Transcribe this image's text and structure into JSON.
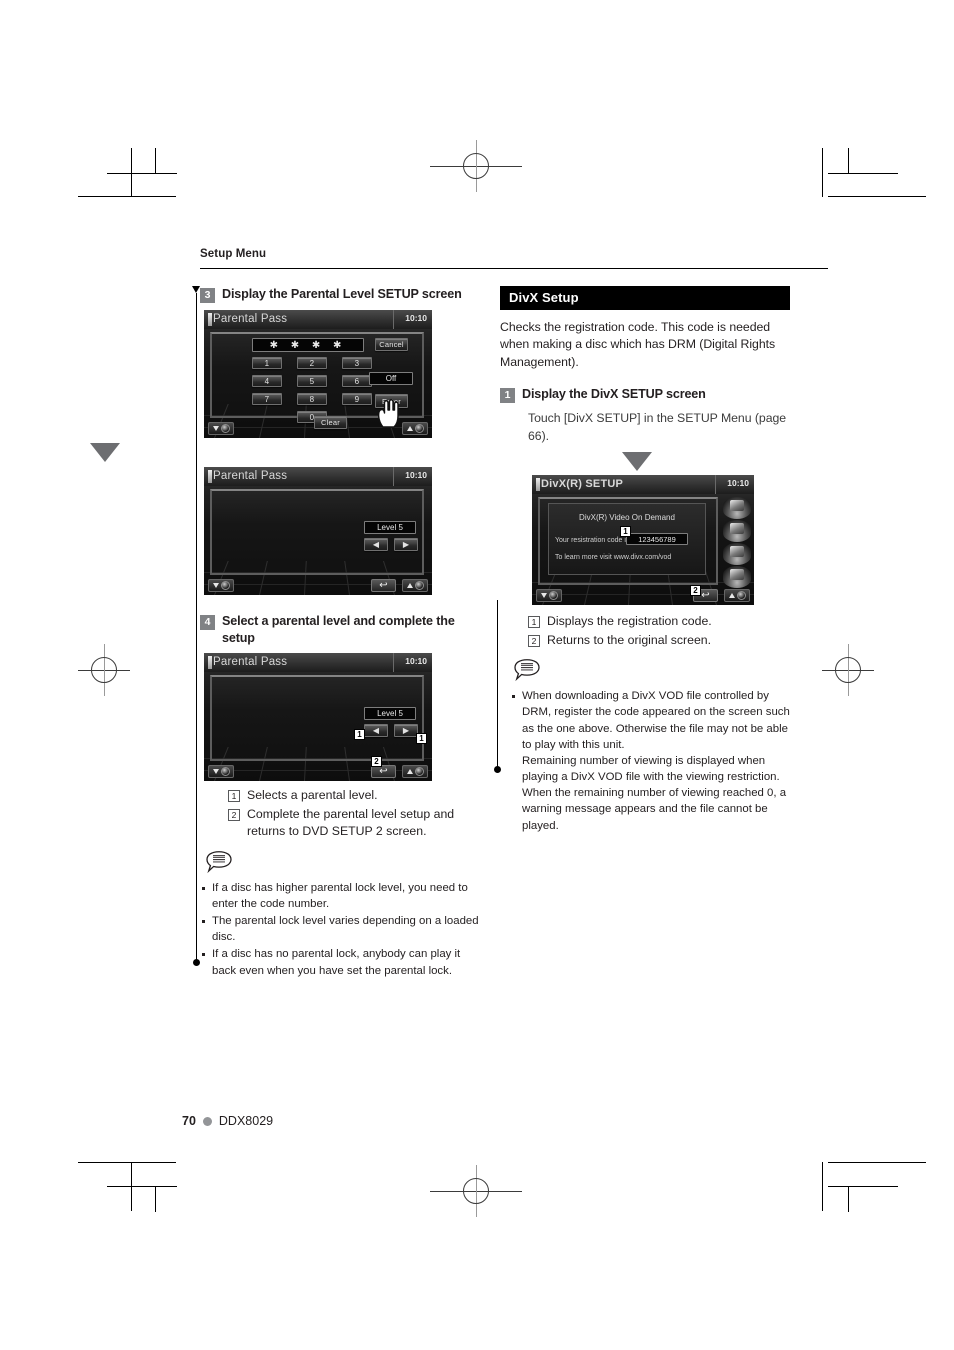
{
  "page": {
    "running_head": "Setup Menu",
    "number": "70",
    "model": "DDX8029"
  },
  "left_column": {
    "step3": {
      "number": "3",
      "title": "Display the Parental Level SETUP screen"
    },
    "step4": {
      "number": "4",
      "title": "Select a parental level and complete the setup"
    },
    "callouts": [
      {
        "num": "1",
        "text": "Selects a parental level."
      },
      {
        "num": "2",
        "text": "Complete the parental level setup and returns to DVD SETUP 2 screen."
      }
    ],
    "notes": [
      "If a disc has higher parental lock level, you need to enter the code number.",
      "The parental lock level varies depending on a loaded disc.",
      "If a disc has no parental lock, anybody can play it back even when you have set the parental lock."
    ]
  },
  "right_column": {
    "section_title": "DivX Setup",
    "intro": "Checks the registration code. This code is needed when making a disc which has DRM (Digital Rights Management).",
    "step1": {
      "number": "1",
      "title": "Display the DivX SETUP screen",
      "body": "Touch [DivX SETUP] in the SETUP Menu (page 66)."
    },
    "callouts": [
      {
        "num": "1",
        "text": "Displays the registration code."
      },
      {
        "num": "2",
        "text": "Returns to the original screen."
      }
    ],
    "notes": [
      "When downloading a DivX VOD file controlled by DRM, register the code appeared on the screen such as the one above. Otherwise the file may not be able to play with this unit.",
      "Remaining number of viewing is displayed when playing a DivX VOD file with the viewing restriction. When the remaining number of viewing  reached 0, a warning message appears and the file cannot be played."
    ]
  },
  "screens": {
    "parental_keypad": {
      "title": "Parental Pass",
      "clock": "10:10",
      "password_display": "✱ ✱ ✱ ✱",
      "keys": [
        "1",
        "2",
        "3",
        "4",
        "5",
        "6",
        "7",
        "8",
        "9",
        "0"
      ],
      "cancel_label": "Cancel",
      "level_value": "Off",
      "enter_label": "Enter",
      "clear_label": "Clear"
    },
    "parental_level": {
      "title": "Parental Pass",
      "clock": "10:10",
      "level_value": "Level 5",
      "prev_label": "◀",
      "next_label": "▶",
      "return_label": "↩"
    },
    "parental_level_callouts": {
      "title": "Parental Pass",
      "clock": "10:10",
      "level_value": "Level 5",
      "prev_label": "◀",
      "next_label": "▶",
      "return_label": "↩",
      "marker_left": "1",
      "marker_right": "1",
      "marker_return": "2"
    },
    "divx_setup": {
      "title": "DivX(R) SETUP",
      "clock": "10:10",
      "heading": "DivX(R) Video On Demand",
      "code_label": "Your resistration code is :",
      "code_value": "123456789",
      "url_line": "To learn more visit www.divx.com/vod",
      "marker_code": "1",
      "marker_return": "2",
      "return_label": "↩"
    }
  },
  "colors": {
    "section_header_bg": "#000000",
    "step_badge_bg": "#808285",
    "arrow_gray": "#6d6e71",
    "footer_dot": "#939598"
  }
}
